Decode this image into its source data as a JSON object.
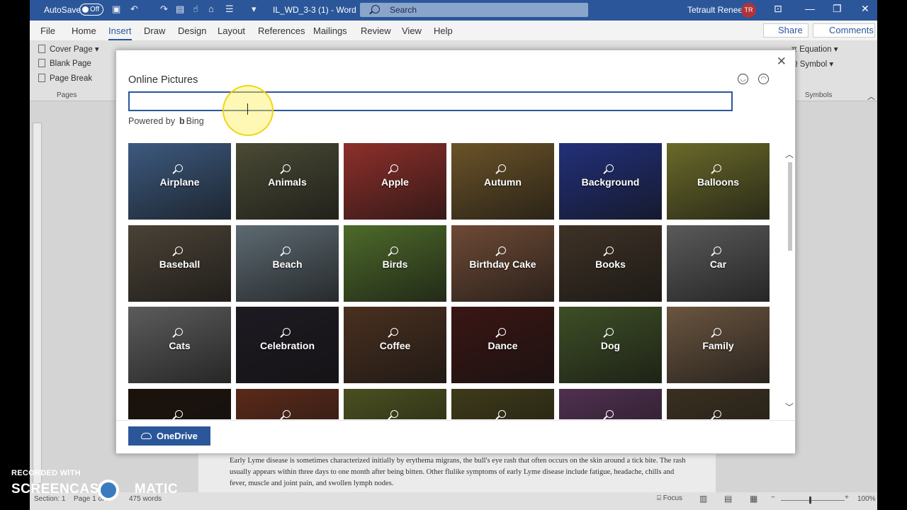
{
  "titlebar": {
    "autosave_label": "AutoSave",
    "autosave_state": "Off",
    "doc_title": "IL_WD_3-3 (1)  -  Word",
    "search_placeholder": "Search",
    "user_name": "Tetrault Renee",
    "user_initials": "TR"
  },
  "tabs": [
    "File",
    "Home",
    "Insert",
    "Draw",
    "Design",
    "Layout",
    "References",
    "Mailings",
    "Review",
    "View",
    "Help"
  ],
  "share_label": "Share",
  "comments_label": "Comments",
  "ribbon": {
    "cover_page": "Cover Page",
    "blank_page": "Blank Page",
    "page_break": "Page Break",
    "pages_group": "Pages",
    "equation": "Equation",
    "symbol": "Symbol",
    "symbols_group": "Symbols"
  },
  "dialog": {
    "title": "Online Pictures",
    "search_value": "",
    "powered_by": "Powered by",
    "bing": "Bing",
    "onedrive_label": "OneDrive",
    "tiles": [
      {
        "label": "Airplane",
        "color": "#3d5a80"
      },
      {
        "label": "Animals",
        "color": "#4a4a35"
      },
      {
        "label": "Apple",
        "color": "#8e2f2a"
      },
      {
        "label": "Autumn",
        "color": "#6b5328"
      },
      {
        "label": "Background",
        "color": "#22307a"
      },
      {
        "label": "Balloons",
        "color": "#6a6a2a"
      },
      {
        "label": "Baseball",
        "color": "#4a4236"
      },
      {
        "label": "Beach",
        "color": "#5d6a72"
      },
      {
        "label": "Birds",
        "color": "#4d6a2a"
      },
      {
        "label": "Birthday Cake",
        "color": "#6e4a35"
      },
      {
        "label": "Books",
        "color": "#3e3226"
      },
      {
        "label": "Car",
        "color": "#5a5a5a"
      },
      {
        "label": "Cats",
        "color": "#5c5c5c"
      },
      {
        "label": "Celebration",
        "color": "#1e1a22"
      },
      {
        "label": "Coffee",
        "color": "#4a3020"
      },
      {
        "label": "Dance",
        "color": "#3a1614"
      },
      {
        "label": "Dog",
        "color": "#3e4f26"
      },
      {
        "label": "Family",
        "color": "#6a5540"
      },
      {
        "label": "",
        "color": "#1c120c"
      },
      {
        "label": "",
        "color": "#5a2a1a"
      },
      {
        "label": "",
        "color": "#4a5020"
      },
      {
        "label": "",
        "color": "#3e3a1a"
      },
      {
        "label": "",
        "color": "#503050"
      },
      {
        "label": "",
        "color": "#3a3020"
      }
    ]
  },
  "doc_text": "Early Lyme disease is sometimes characterized initially by erythema migrans, the bull's eye rash that often occurs on the skin around a tick bite. The rash usually appears within three days to one month after being bitten. Other flulike symptoms of early Lyme disease include fatigue, headache, chills and fever, muscle and joint pain, and swollen lymph nodes.",
  "status": {
    "section": "Section: 1",
    "page": "Page 1 of 1",
    "words": "475 words",
    "focus": "Focus",
    "zoom": "100%"
  },
  "watermark": {
    "line1": "RECORDED WITH",
    "line2": "SCREENCAST",
    "line3": "MATIC"
  }
}
